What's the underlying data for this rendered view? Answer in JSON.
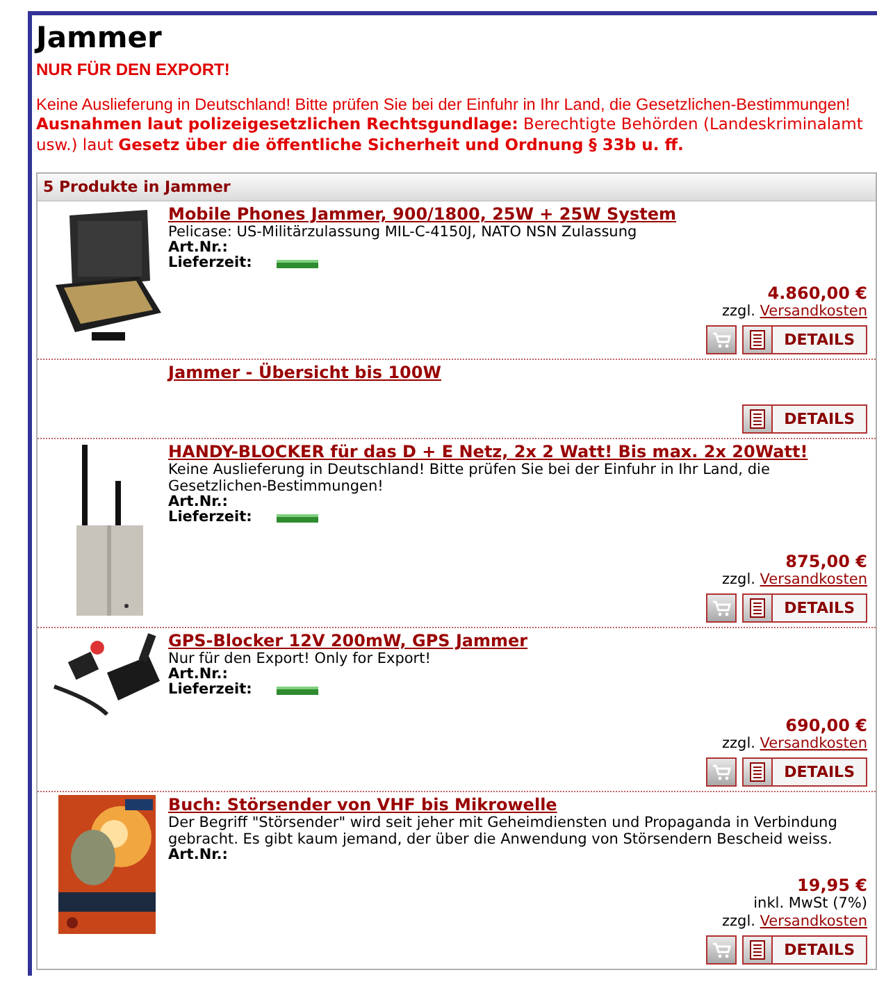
{
  "page_title": "Jammer",
  "export_notice": "NUR FÜR DEN EXPORT!",
  "delivery_notice": "Keine Auslieferung in Deutschland! Bitte prüfen Sie bei der Einfuhr in Ihr Land, die Gesetzlichen-Bestimmungen!",
  "legal_notice": "**Ausnahmen laut polizeigesetzlichen Rechtsgundlage:** Berechtigte Behörden (Landeskriminalamt usw.) laut **Gesetz über die öffentliche Sicherheit und Ordnung § 33b u. ff.**",
  "listing": {
    "header": "5 Produkte in Jammer",
    "products": [
      {
        "title": "Mobile Phones Jammer, 900/1800, 25W + 25W System",
        "picture": true,
        "description": "Pelicase: US-Militärzulassung MIL-C-4150J, NATO NSN Zulassung",
        "art_nr_label": "Art.Nr.:",
        "delivery_label": "Lieferzeit:",
        "price": "4.860,00 €",
        "shipping_prefix": "zzgl.",
        "shipping_link": "Versandkosten",
        "cart": true,
        "details": "DETAILS"
      },
      {
        "title": "Jammer - Übersicht bis 100W",
        "picture": false,
        "cart": false,
        "details": "DETAILS"
      },
      {
        "title": "HANDY-BLOCKER für das D + E Netz, 2x 2 Watt! Bis max. 2x 20Watt!",
        "picture": true,
        "description": "Keine Auslieferung in Deutschland! Bitte prüfen Sie bei der Einfuhr in Ihr Land, die Gesetzlichen-Bestimmungen!",
        "art_nr_label": "Art.Nr.:",
        "delivery_label": "Lieferzeit:",
        "price": "875,00 €",
        "shipping_prefix": "zzgl.",
        "shipping_link": "Versandkosten",
        "cart": true,
        "details": "DETAILS"
      },
      {
        "title": "GPS-Blocker 12V 200mW, GPS Jammer",
        "picture": true,
        "description": "Nur für den Export! Only for Export!",
        "art_nr_label": "Art.Nr.:",
        "delivery_label": "Lieferzeit:",
        "price": "690,00 €",
        "shipping_prefix": "zzgl.",
        "shipping_link": "Versandkosten",
        "cart": true,
        "details": "DETAILS"
      },
      {
        "title": "Buch: Störsender von VHF bis Mikrowelle",
        "picture": true,
        "description": "Der Begriff \"Störsender\" wird seit jeher mit Geheimdiensten und Propaganda in Verbindung gebracht. Es gibt kaum jemand, der über die Anwendung von Störsendern Bescheid weiss.",
        "art_nr_label": "Art.Nr.:",
        "price": "19,95 €",
        "tax_note": "inkl. MwSt (7%)",
        "shipping_prefix": "zzgl.",
        "shipping_link": "Versandkosten",
        "cart": true,
        "details": "DETAILS"
      }
    ]
  }
}
